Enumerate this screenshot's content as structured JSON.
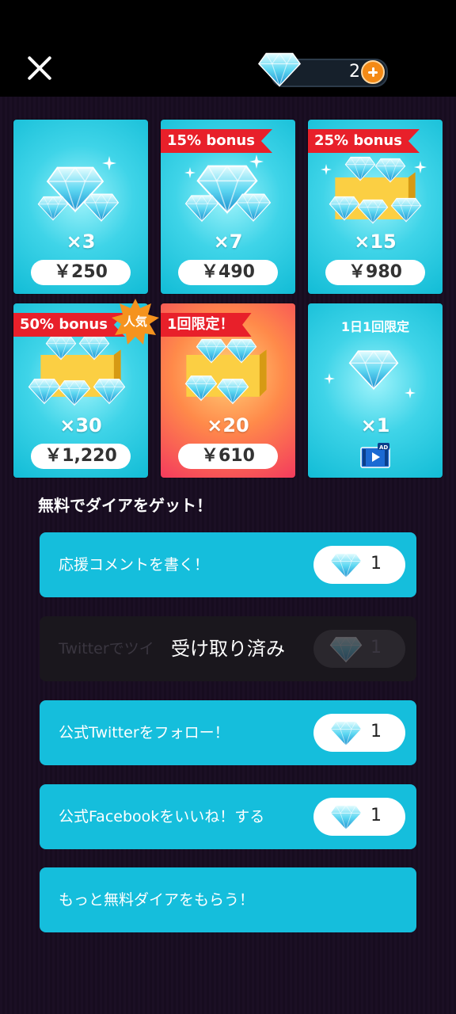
{
  "header": {
    "balance": "2"
  },
  "packs": [
    {
      "ribbon": "",
      "qty": "×3",
      "price": "￥250"
    },
    {
      "ribbon": "15% bonus",
      "qty": "×7",
      "price": "￥490"
    },
    {
      "ribbon": "25% bonus",
      "qty": "×15",
      "price": "￥980"
    },
    {
      "ribbon": "50% bonus",
      "badge": "人気",
      "qty": "×30",
      "price": "￥1,220"
    },
    {
      "ribbon": "1回限定！",
      "qty": "×20",
      "price": "￥610"
    },
    {
      "label": "1日1回限定",
      "qty": "×1"
    }
  ],
  "free_section": {
    "title": "無料でダイアをゲット！",
    "items": [
      {
        "label": "応援コメントを書く！",
        "reward": "1"
      },
      {
        "label": "Twitterでツイ",
        "reward": "1",
        "status": "受け取り済み"
      },
      {
        "label": "公式Twitterをフォロー！",
        "reward": "1"
      },
      {
        "label": "公式Facebookをいいね！する",
        "reward": "1"
      },
      {
        "label": "もっと無料ダイアをもらう！"
      }
    ]
  },
  "colors": {
    "accent": "#15bedc",
    "ribbon": "#e8202a",
    "plus": "#f48a16"
  },
  "icons": [
    "close-icon",
    "diamond-icon",
    "plus-icon",
    "video-ad-icon"
  ]
}
